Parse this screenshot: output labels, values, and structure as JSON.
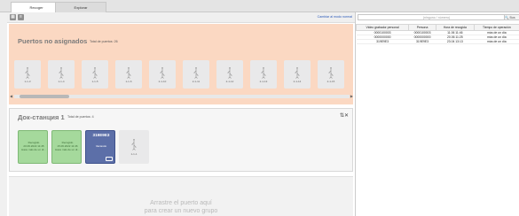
{
  "tabs": [
    {
      "label": "Recoger"
    },
    {
      "label": "Explorar"
    }
  ],
  "toolbar": {
    "mode_link": "Cambiar al modo normal"
  },
  "unassigned": {
    "title": "Puertos no asignados",
    "subtitle": "Total de puertos: 26",
    "ports": [
      "1-1-3",
      "1-1-4",
      "1-1-5",
      "1-1-6",
      "2-1-10",
      "2-1-11",
      "2-1-12",
      "2-1-13",
      "2-1-14",
      "2-1-15"
    ]
  },
  "dock": {
    "title": "Док-станция 1",
    "subtitle": "Total de puertos: 4",
    "ports": [
      {
        "line1": "Recogido",
        "line2": "20.06.2022 11:45",
        "line3": "Hace más de un dí...",
        "style": "green"
      },
      {
        "line1": "Recogido",
        "line2": "15.06.2022 11:46",
        "line3": "Hace más de un dí...",
        "style": "green"
      },
      {
        "line1": "319E9E3",
        "line2": "",
        "line3": "Vaciando",
        "style": "blue"
      },
      {
        "line1": "",
        "line2": "",
        "line3": "1-1-1",
        "style": "grey"
      }
    ]
  },
  "dropzone": {
    "line1": "Arrastre el puerto aquí",
    "line2": "para crear un nuevo grupo"
  },
  "search": {
    "placeholder": "(ninguno / número)",
    "button": "Bus"
  },
  "table": {
    "headers": [
      "Video grabador personal",
      "Persona",
      "Hora de recogida",
      "Tiempo de operación"
    ],
    "rows": [
      [
        "0000100003",
        "0000100003",
        "11.06 11:46",
        "más de un día"
      ],
      [
        "0000000000",
        "0000000000",
        "20.06 11:25",
        "más de un día"
      ],
      [
        "319E9E3",
        "319E9E3",
        "23.04 13:13",
        "más de un día"
      ]
    ]
  },
  "colors": {
    "unassigned_bg": "#fbd8c2",
    "green_port": "#a5d99c",
    "blue_port": "#5c6fa8",
    "link": "#2a59b8"
  }
}
